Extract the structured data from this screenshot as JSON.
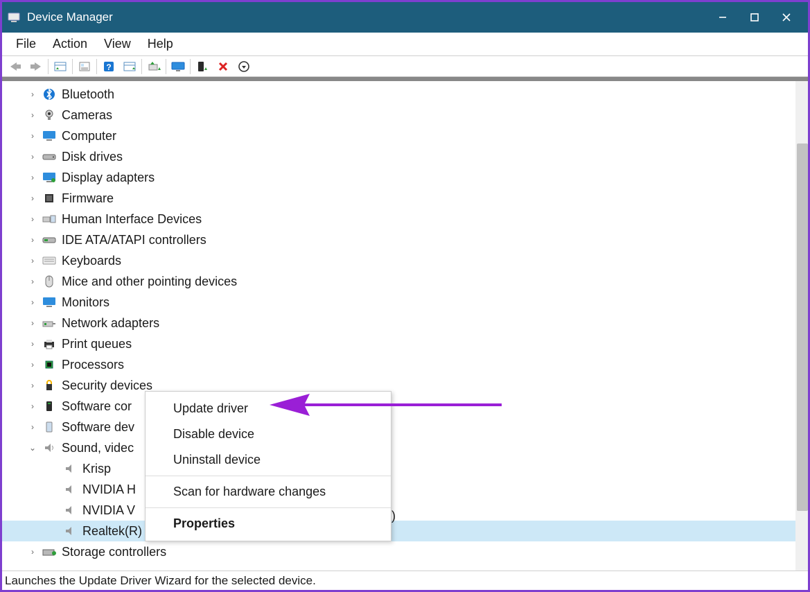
{
  "titlebar": {
    "title": "Device Manager"
  },
  "menubar": [
    "File",
    "Action",
    "View",
    "Help"
  ],
  "toolbar_icons": [
    "back",
    "forward",
    "show-all",
    "properties",
    "help",
    "scan",
    "update",
    "monitor",
    "enable",
    "disable",
    "uninstall"
  ],
  "tree": [
    {
      "name": "Bluetooth",
      "icon": "bluetooth",
      "exp": ">"
    },
    {
      "name": "Cameras",
      "icon": "camera",
      "exp": ">"
    },
    {
      "name": "Computer",
      "icon": "computer",
      "exp": ">"
    },
    {
      "name": "Disk drives",
      "icon": "disk",
      "exp": ">"
    },
    {
      "name": "Display adapters",
      "icon": "display",
      "exp": ">"
    },
    {
      "name": "Firmware",
      "icon": "firmware",
      "exp": ">"
    },
    {
      "name": "Human Interface Devices",
      "icon": "hid",
      "exp": ">"
    },
    {
      "name": "IDE ATA/ATAPI controllers",
      "icon": "ide",
      "exp": ">"
    },
    {
      "name": "Keyboards",
      "icon": "keyboard",
      "exp": ">"
    },
    {
      "name": "Mice and other pointing devices",
      "icon": "mouse",
      "exp": ">"
    },
    {
      "name": "Monitors",
      "icon": "monitor",
      "exp": ">"
    },
    {
      "name": "Network adapters",
      "icon": "network",
      "exp": ">"
    },
    {
      "name": "Print queues",
      "icon": "printer",
      "exp": ">"
    },
    {
      "name": "Processors",
      "icon": "cpu",
      "exp": ">"
    },
    {
      "name": "Security devices",
      "icon": "security",
      "exp": ">"
    },
    {
      "name": "Software cor",
      "icon": "swcomp",
      "exp": ">",
      "truncated": true
    },
    {
      "name": "Software dev",
      "icon": "swdev",
      "exp": ">",
      "truncated": true
    },
    {
      "name": "Sound, videc",
      "icon": "sound",
      "exp": "v",
      "truncated": true,
      "expanded": true,
      "children": [
        {
          "name": "Krisp",
          "icon": "speaker"
        },
        {
          "name": "NVIDIA H",
          "icon": "speaker",
          "truncated": true
        },
        {
          "name": "NVIDIA V",
          "icon": "speaker",
          "truncated": true
        },
        {
          "name": "Realtek(R) Audio",
          "icon": "speaker",
          "selected": true
        }
      ]
    },
    {
      "name": "Storage controllers",
      "icon": "storage",
      "exp": ">"
    }
  ],
  "trailing_paren": ")",
  "context_menu": {
    "items": [
      {
        "label": "Update driver"
      },
      {
        "label": "Disable device"
      },
      {
        "label": "Uninstall device"
      },
      {
        "sep": true
      },
      {
        "label": "Scan for hardware changes"
      },
      {
        "sep": true
      },
      {
        "label": "Properties",
        "bold": true
      }
    ]
  },
  "statusbar": "Launches the Update Driver Wizard for the selected device."
}
